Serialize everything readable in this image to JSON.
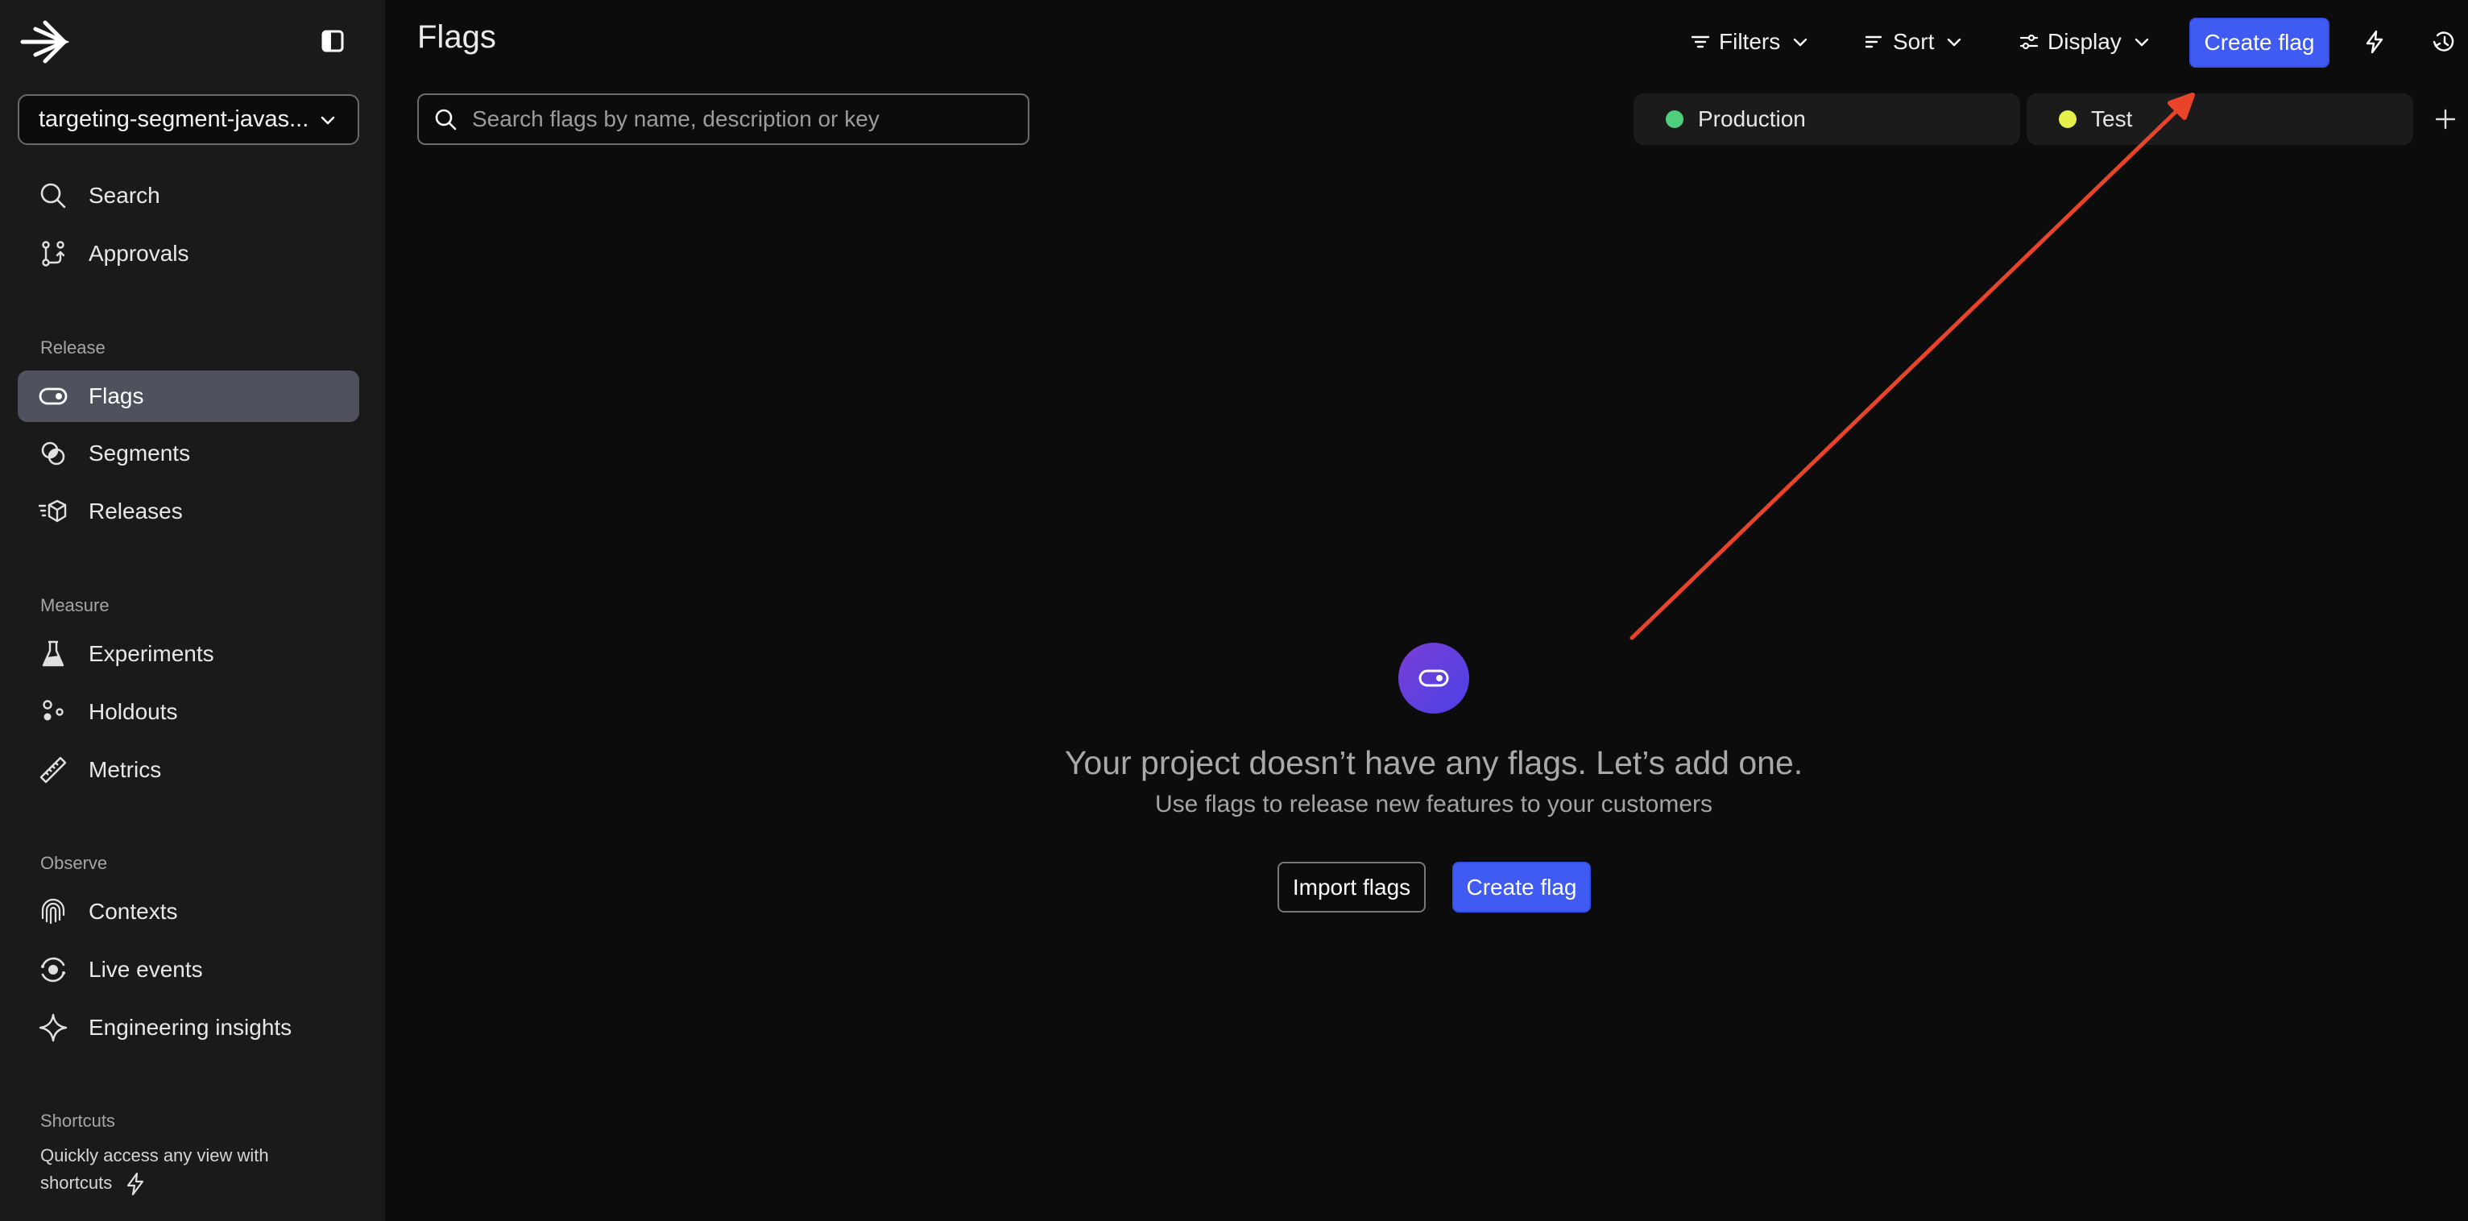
{
  "sidebar": {
    "project_selector": "targeting-segment-javas...",
    "top_items": [
      {
        "label": "Search",
        "icon": "search-icon"
      },
      {
        "label": "Approvals",
        "icon": "approvals-icon"
      }
    ],
    "sections": [
      {
        "title": "Release",
        "items": [
          {
            "label": "Flags",
            "icon": "toggle-icon",
            "active": true
          },
          {
            "label": "Segments",
            "icon": "segments-icon"
          },
          {
            "label": "Releases",
            "icon": "releases-icon"
          }
        ]
      },
      {
        "title": "Measure",
        "items": [
          {
            "label": "Experiments",
            "icon": "flask-icon"
          },
          {
            "label": "Holdouts",
            "icon": "holdouts-icon"
          },
          {
            "label": "Metrics",
            "icon": "ruler-icon"
          }
        ]
      },
      {
        "title": "Observe",
        "items": [
          {
            "label": "Contexts",
            "icon": "fingerprint-icon"
          },
          {
            "label": "Live events",
            "icon": "live-events-icon"
          },
          {
            "label": "Engineering insights",
            "icon": "sparkle-icon"
          }
        ]
      }
    ],
    "shortcuts": {
      "title": "Shortcuts",
      "text": "Quickly access any view with shortcuts"
    }
  },
  "header": {
    "title": "Flags",
    "filters_label": "Filters",
    "sort_label": "Sort",
    "display_label": "Display",
    "create_flag_label": "Create flag"
  },
  "search": {
    "placeholder": "Search flags by name, description or key",
    "value": ""
  },
  "environments": [
    {
      "label": "Production",
      "color": "#4fcf7e"
    },
    {
      "label": "Test",
      "color": "#e7f04a"
    }
  ],
  "empty_state": {
    "title": "Your project doesn’t have any flags. Let’s add one.",
    "subtitle": "Use flags to release new features to your customers",
    "import_label": "Import flags",
    "create_label": "Create flag"
  },
  "colors": {
    "accent": "#405bf1",
    "annotation_arrow": "#e8442a",
    "sidebar_bg": "#1a1a1b",
    "main_bg": "#0c0c0d"
  }
}
